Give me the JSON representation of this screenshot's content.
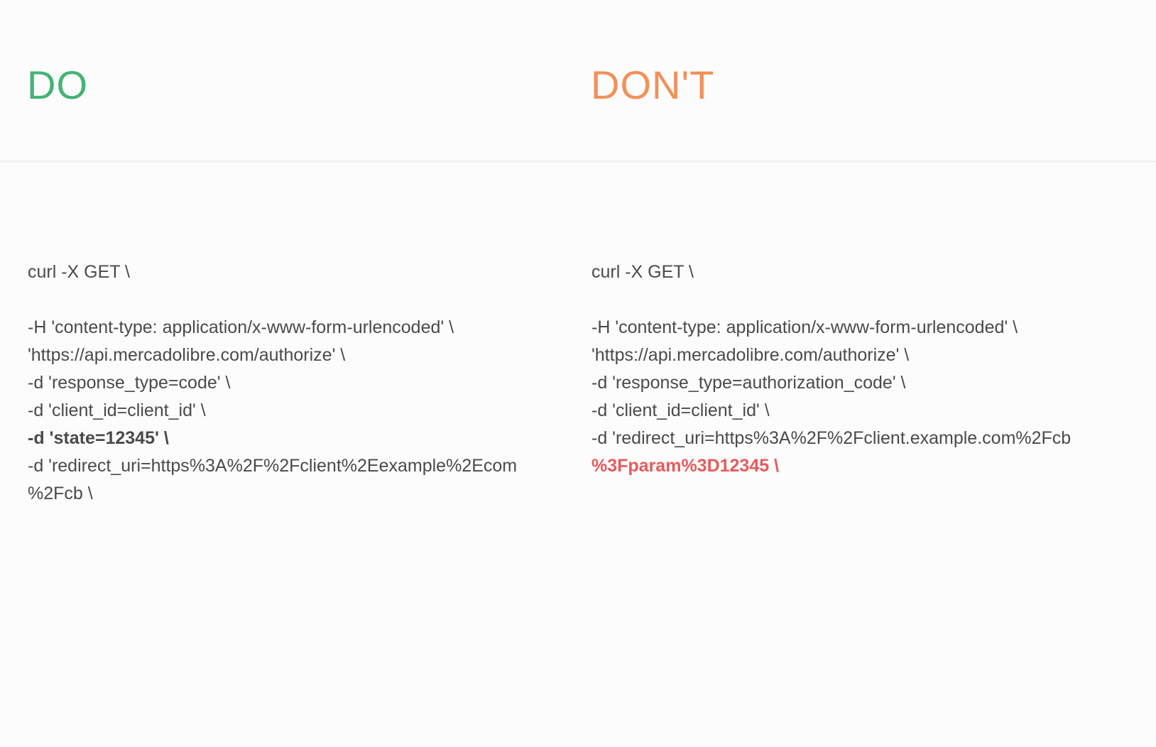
{
  "do": {
    "title": "DO",
    "lines": [
      "curl -X GET \\",
      "-H 'content-type: application/x-www-form-urlencoded' \\",
      "'https://api.mercadolibre.com/authorize' \\",
      "-d 'response_type=code' \\",
      "-d 'client_id=client_id' \\",
      "-d 'state=12345' \\",
      "-d 'redirect_uri=https%3A%2F%2Fclient%2Eexample%2Ecom",
      "%2Fcb  \\"
    ]
  },
  "dont": {
    "title": "DON'T",
    "lines": [
      "curl -X GET \\",
      "-H 'content-type: application/x-www-form-urlencoded' \\",
      "'https://api.mercadolibre.com/authorize' \\",
      "-d 'response_type=authorization_code' \\",
      "-d 'client_id=client_id' \\",
      "-d 'redirect_uri=https%3A%2F%2Fclient.example.com%2Fcb",
      "%3Fparam%3D12345  \\"
    ]
  },
  "colors": {
    "do": "#43b476",
    "dont": "#f39058",
    "error": "#e85a5a",
    "text": "#4a4a4a"
  }
}
